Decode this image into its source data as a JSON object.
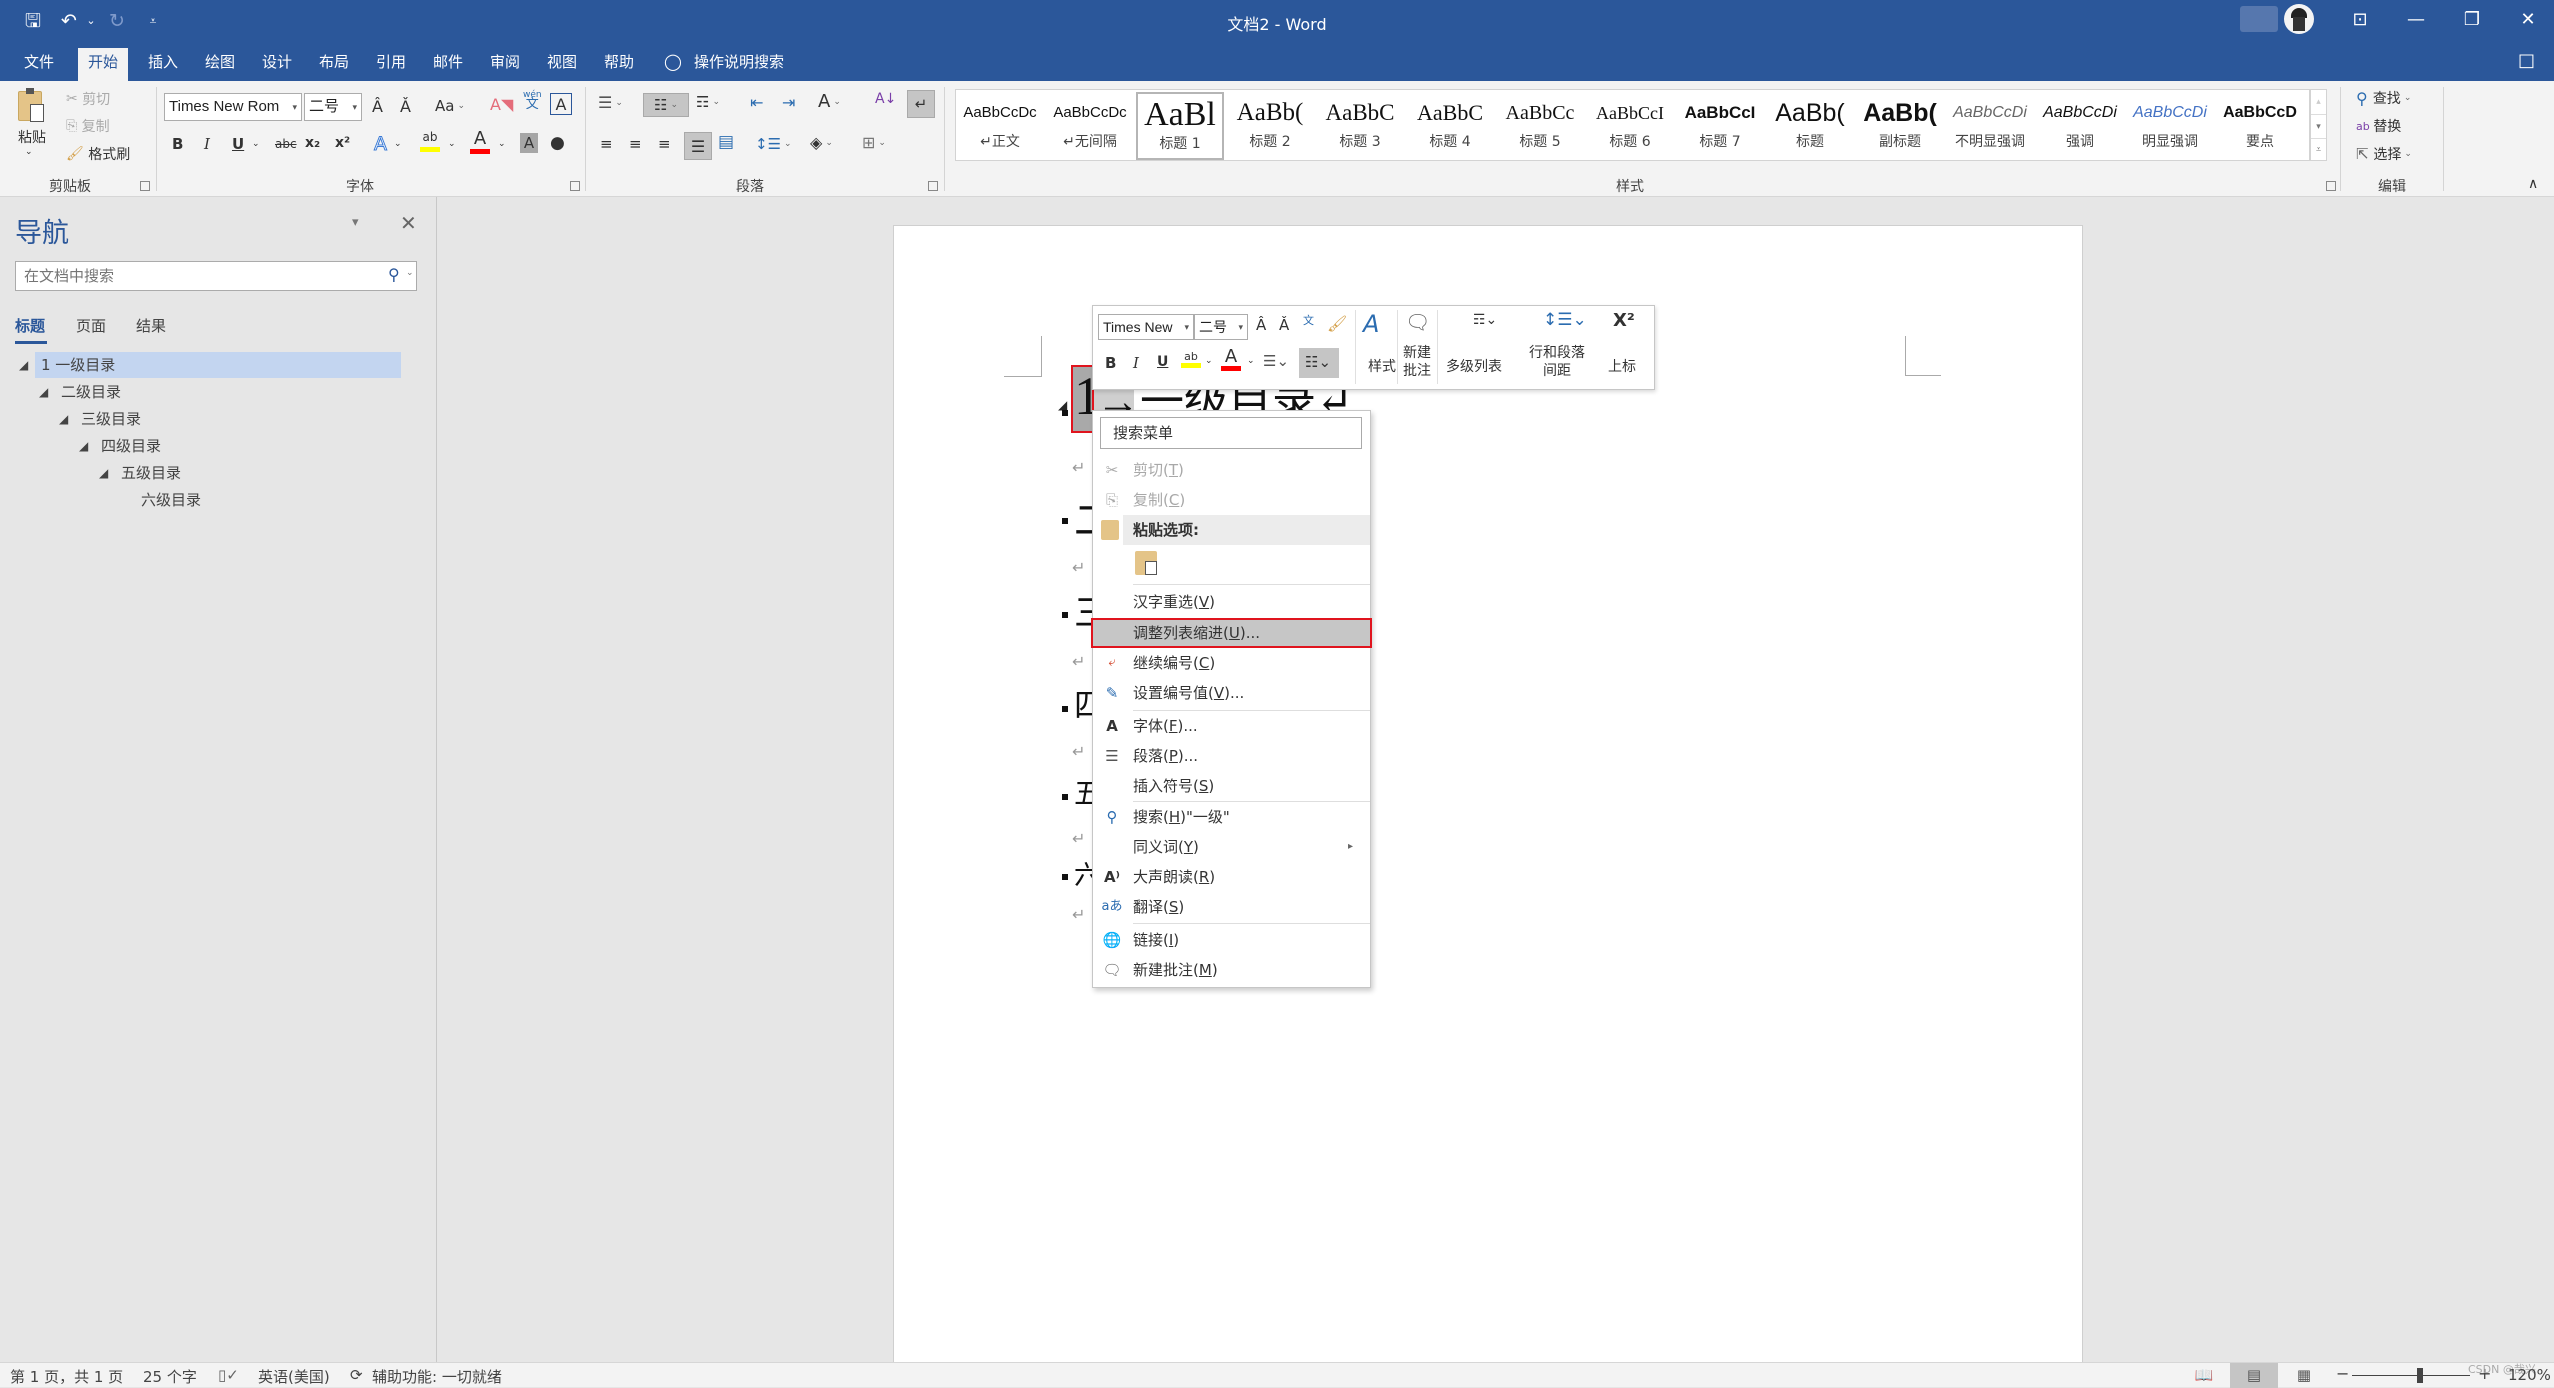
{
  "titlebar": {
    "title": "文档2  -  Word",
    "qat": {
      "save_icon": "💾",
      "undo_icon": "↶",
      "undo_dd": "⌄",
      "redo_icon": "↻",
      "customize_icon": "⩡"
    },
    "controls": {
      "ribbon_display_icon": "⊡",
      "minimize_icon": "—",
      "restore_icon": "❐",
      "close_icon": "✕",
      "comments_icon": "🗨"
    }
  },
  "tabs": [
    {
      "label": "文件"
    },
    {
      "label": "开始"
    },
    {
      "label": "插入"
    },
    {
      "label": "绘图"
    },
    {
      "label": "设计"
    },
    {
      "label": "布局"
    },
    {
      "label": "引用"
    },
    {
      "label": "邮件"
    },
    {
      "label": "审阅"
    },
    {
      "label": "视图"
    },
    {
      "label": "帮助"
    }
  ],
  "tell_me": {
    "icon": "💡",
    "label": "操作说明搜索"
  },
  "ribbon": {
    "clipboard": {
      "label": "剪贴板",
      "paste": "粘贴",
      "cut": "剪切",
      "copy": "复制",
      "format_painter": "格式刷"
    },
    "font": {
      "label": "字体",
      "font_name": "Times New Rom",
      "font_size": "二号",
      "grow": "A",
      "shrink": "A",
      "change_case": "Aa",
      "clear": "A",
      "phonetic": "wén",
      "border": "A",
      "bold": "B",
      "italic": "I",
      "underline": "U",
      "strike": "abc",
      "sub": "x₂",
      "sup": "x²",
      "effects": "A",
      "highlight": "ab",
      "color": "A",
      "shading": "A",
      "enclose": "㊄"
    },
    "paragraph": {
      "label": "段落"
    },
    "styles": {
      "label": "样式",
      "items": [
        {
          "preview": "AaBbCcDc",
          "name": "↵正文"
        },
        {
          "preview": "AaBbCcDc",
          "name": "↵无间隔"
        },
        {
          "preview": "AaBl",
          "name": "标题 1"
        },
        {
          "preview": "AaBb(",
          "name": "标题 2"
        },
        {
          "preview": "AaBbC",
          "name": "标题 3"
        },
        {
          "preview": "AaBbC",
          "name": "标题 4"
        },
        {
          "preview": "AaBbCc",
          "name": "标题 5"
        },
        {
          "preview": "AaBbCcI",
          "name": "标题 6"
        },
        {
          "preview": "AaBbCcI",
          "name": "标题 7"
        },
        {
          "preview": "AaBb(",
          "name": "标题"
        },
        {
          "preview": "AaBb(",
          "name": "副标题"
        },
        {
          "preview": "AaBbCcDi",
          "name": "不明显强调"
        },
        {
          "preview": "AaBbCcDi",
          "name": "强调"
        },
        {
          "preview": "AaBbCcDi",
          "name": "明显强调"
        },
        {
          "preview": "AaBbCcD",
          "name": "要点"
        }
      ]
    },
    "editing": {
      "label": "编辑",
      "find": "查找",
      "replace": "替换",
      "select": "选择"
    }
  },
  "nav": {
    "title": "导航",
    "search_placeholder": "在文档中搜索",
    "tabs": [
      {
        "label": "标题"
      },
      {
        "label": "页面"
      },
      {
        "label": "结果"
      }
    ],
    "tree": [
      {
        "label": "1 一级目录",
        "level": 1,
        "selected": true
      },
      {
        "label": "二级目录",
        "level": 2
      },
      {
        "label": "三级目录",
        "level": 3
      },
      {
        "label": "四级目录",
        "level": 4
      },
      {
        "label": "五级目录",
        "level": 5
      },
      {
        "label": "六级目录",
        "level": 6
      }
    ]
  },
  "document": {
    "headings": [
      {
        "number": "1",
        "text": "→一级目录↵"
      },
      {
        "text": "二"
      },
      {
        "text": "三"
      },
      {
        "text": "四"
      },
      {
        "text": "五"
      },
      {
        "text": "六"
      }
    ],
    "para_mark": "↵"
  },
  "minibar": {
    "font_name": "Times New",
    "font_size": "二号",
    "styles": "样式",
    "new_comment": "新建批注",
    "multilevel": "多级列表",
    "spacing": "行和段落间距",
    "superscript": "上标"
  },
  "context_menu": {
    "search_placeholder": "搜索菜单",
    "items": [
      {
        "icon": "✂",
        "label": "剪切(",
        "key": "T",
        "suffix": ")",
        "disabled": true
      },
      {
        "icon": "⎘",
        "label": "复制(",
        "key": "C",
        "suffix": ")",
        "disabled": true
      },
      {
        "label": "粘贴选项:",
        "header": true
      },
      {
        "label": "汉字重选(",
        "key": "V",
        "suffix": ")"
      },
      {
        "label": "调整列表缩进(",
        "key": "U",
        "suffix": ")...",
        "highlighted": true
      },
      {
        "label": "继续编号(",
        "key": "C",
        "suffix": ")"
      },
      {
        "label": "设置编号值(",
        "key": "V",
        "suffix": ")..."
      },
      {
        "label": "字体(",
        "key": "F",
        "suffix": ")..."
      },
      {
        "label": "段落(",
        "key": "P",
        "suffix": ")..."
      },
      {
        "label": "插入符号(",
        "key": "S",
        "suffix": ")"
      },
      {
        "label": "搜索(",
        "key": "H",
        "suffix": ")\"一级\""
      },
      {
        "label": "同义词(",
        "key": "Y",
        "suffix": ")"
      },
      {
        "label": "大声朗读(",
        "key": "R",
        "suffix": ")"
      },
      {
        "label": "翻译(",
        "key": "S",
        "suffix": ")"
      },
      {
        "label": "链接(",
        "key": "I",
        "suffix": ")"
      },
      {
        "label": "新建批注(",
        "key": "M",
        "suffix": ")"
      }
    ]
  },
  "statusbar": {
    "page": "第 1 页，共 1 页",
    "words": "25 个字",
    "language": "英语(美国)",
    "accessibility": "辅助功能: 一切就绪",
    "zoom": "120%",
    "zoom_level_percent": 120,
    "watermark": "CSDN @哉兴"
  },
  "colors": {
    "accent": "#2b579a",
    "highlight_outline": "#e0141e",
    "highlight_yellow": "#ffff00",
    "font_red": "#ff0000"
  }
}
